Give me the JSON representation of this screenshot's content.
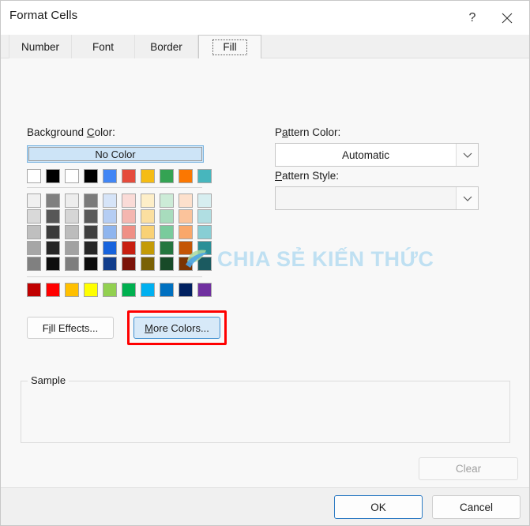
{
  "window": {
    "title": "Format Cells",
    "help_icon": "question-mark-icon",
    "close_icon": "close-x-icon"
  },
  "tabs": [
    {
      "label": "Number",
      "active": false
    },
    {
      "label": "Font",
      "active": false
    },
    {
      "label": "Border",
      "active": false
    },
    {
      "label": "Fill",
      "active": true
    }
  ],
  "background_color": {
    "label": "Background Color:",
    "label_prefix": "Background ",
    "label_accel": "C",
    "label_suffix": "olor:",
    "no_color_label": "No Color",
    "no_color_selected": true,
    "theme_row": [
      "#ffffff",
      "#000000",
      "#ffffff",
      "#000000",
      "#4286f5",
      "#e54b3c",
      "#f5bc14",
      "#34a353",
      "#fb7701",
      "#47b6bd"
    ],
    "tint_rows": [
      [
        "#f0f0f0",
        "#808080",
        "#ededed",
        "#7b7b7b",
        "#d6e4f8",
        "#fadbd7",
        "#fdeec8",
        "#ccebd7",
        "#fde0cc",
        "#d7eef0"
      ],
      [
        "#d9d9d9",
        "#575757",
        "#d6d6d6",
        "#595959",
        "#b5cdf3",
        "#f4b6b0",
        "#fbdfa0",
        "#a8dcbd",
        "#fbc39b",
        "#b0dee2"
      ],
      [
        "#bfbfbf",
        "#3b3b3b",
        "#bcbcbc",
        "#3f3f3f",
        "#8fb5ee",
        "#ef8f85",
        "#f9d175",
        "#79cb9c",
        "#f9a76a",
        "#88ced4"
      ],
      [
        "#a6a6a6",
        "#262626",
        "#a2a2a2",
        "#262626",
        "#1763dd",
        "#c81e10",
        "#c49b06",
        "#24763f",
        "#c45505",
        "#2a8f97"
      ],
      [
        "#808080",
        "#0d0d0d",
        "#7e7e7e",
        "#0d0d0d",
        "#123e8c",
        "#7c1309",
        "#7a6104",
        "#184a28",
        "#7b3503",
        "#1b5a60"
      ]
    ],
    "standard_row": [
      "#c00000",
      "#ff0000",
      "#ffc000",
      "#ffff00",
      "#92d050",
      "#00b050",
      "#00b0f0",
      "#0070c0",
      "#002060",
      "#7030a0"
    ]
  },
  "buttons": {
    "fill_effects": {
      "label": "Fill Effects...",
      "prefix": "F",
      "accel": "i",
      "suffix": "ll Effects..."
    },
    "more_colors": {
      "label": "More Colors...",
      "accel": "M",
      "suffix": "ore Colors...",
      "highlighted": true
    },
    "clear": {
      "label": "Clear",
      "disabled": true
    },
    "ok": {
      "label": "OK",
      "default": true
    },
    "cancel": {
      "label": "Cancel"
    }
  },
  "pattern_color": {
    "label": "Pattern Color:",
    "label_prefix": "P",
    "label_accel": "a",
    "label_suffix": "ttern Color:",
    "value": "Automatic",
    "dropdown_icon": "chevron-down-icon"
  },
  "pattern_style": {
    "label": "Pattern Style:",
    "label_accel": "P",
    "label_suffix": "attern Style:",
    "value": "",
    "dropdown_icon": "chevron-down-icon"
  },
  "sample": {
    "legend": "Sample",
    "content": ""
  },
  "watermark": {
    "text": "CHIA SẺ KIẾN THỨC",
    "color": "#bfe0f2",
    "logo_icon": "swoosh-leaf-logo-icon"
  },
  "colors": {
    "accent": "#2f7cc4",
    "highlight": "#ff0000",
    "selection_fill": "#cde4f7",
    "panel_bg": "#f8f8f8",
    "footer_bg": "#f0f0f0"
  }
}
